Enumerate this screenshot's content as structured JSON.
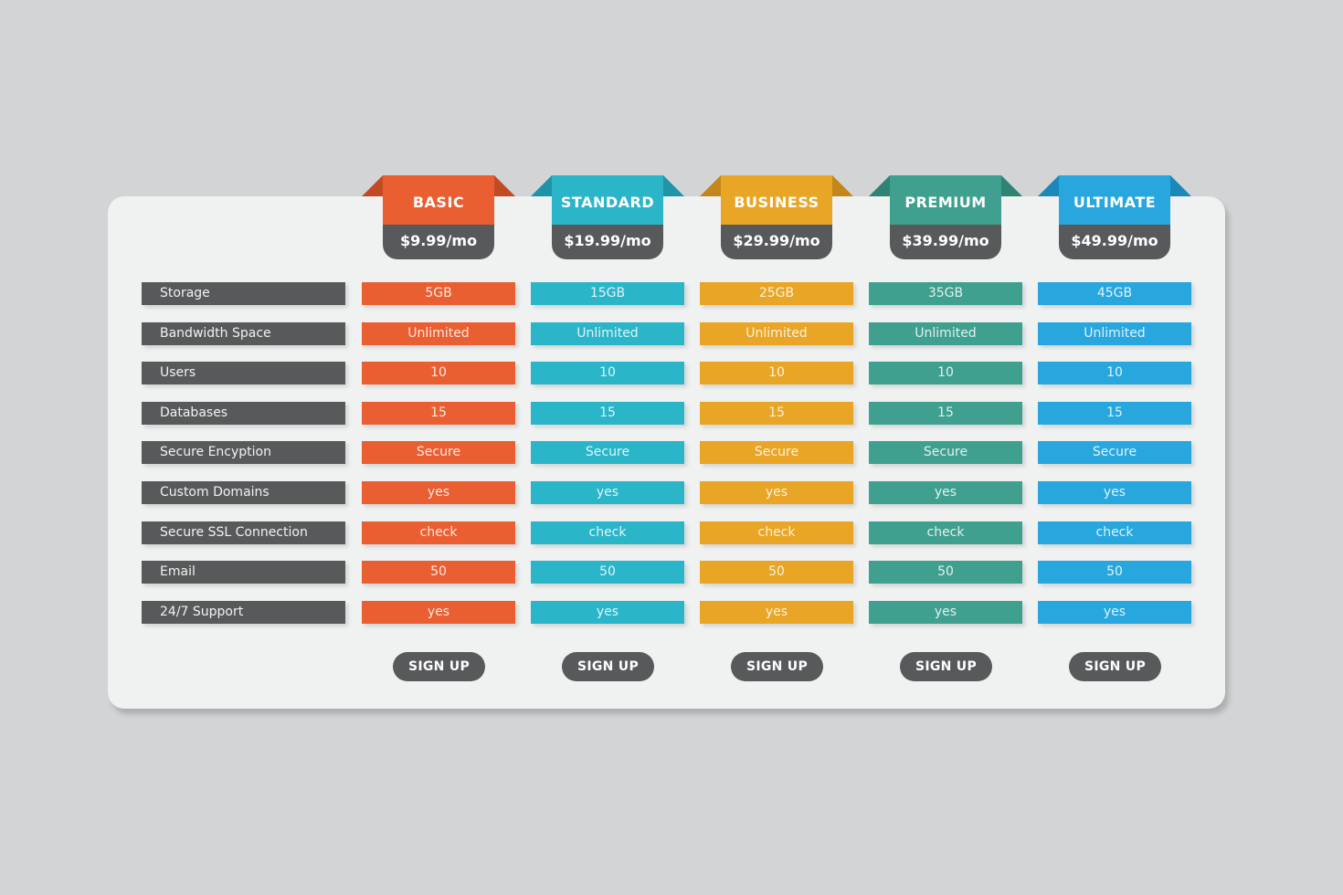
{
  "features": [
    "Storage",
    "Bandwidth Space",
    "Users",
    "Databases",
    "Secure Encyption",
    "Custom Domains",
    "Secure SSL Connection",
    "Email",
    "24/7 Support"
  ],
  "plans": [
    {
      "name": "BASIC",
      "price": "$9.99/mo",
      "color": "#e95f32",
      "wing": "#c24a24",
      "values": [
        "5GB",
        "Unlimited",
        "10",
        "15",
        "Secure",
        "yes",
        "check",
        "50",
        "yes"
      ],
      "button": "SIGN UP"
    },
    {
      "name": "STANDARD",
      "price": "$19.99/mo",
      "color": "#2bb5c9",
      "wing": "#1f94a6",
      "values": [
        "15GB",
        "Unlimited",
        "10",
        "15",
        "Secure",
        "yes",
        "check",
        "50",
        "yes"
      ],
      "button": "SIGN UP"
    },
    {
      "name": "BUSINESS",
      "price": "$29.99/mo",
      "color": "#e9a526",
      "wing": "#c3861a",
      "values": [
        "25GB",
        "Unlimited",
        "10",
        "15",
        "Secure",
        "yes",
        "check",
        "50",
        "yes"
      ],
      "button": "SIGN UP"
    },
    {
      "name": "PREMIUM",
      "price": "$39.99/mo",
      "color": "#3fa08f",
      "wing": "#2f8374",
      "values": [
        "35GB",
        "Unlimited",
        "10",
        "15",
        "Secure",
        "yes",
        "check",
        "50",
        "yes"
      ],
      "button": "SIGN UP"
    },
    {
      "name": "ULTIMATE",
      "price": "$49.99/mo",
      "color": "#27a7de",
      "wing": "#1c88b8",
      "values": [
        "45GB",
        "Unlimited",
        "10",
        "15",
        "Secure",
        "yes",
        "check",
        "50",
        "yes"
      ],
      "button": "SIGN UP"
    }
  ]
}
